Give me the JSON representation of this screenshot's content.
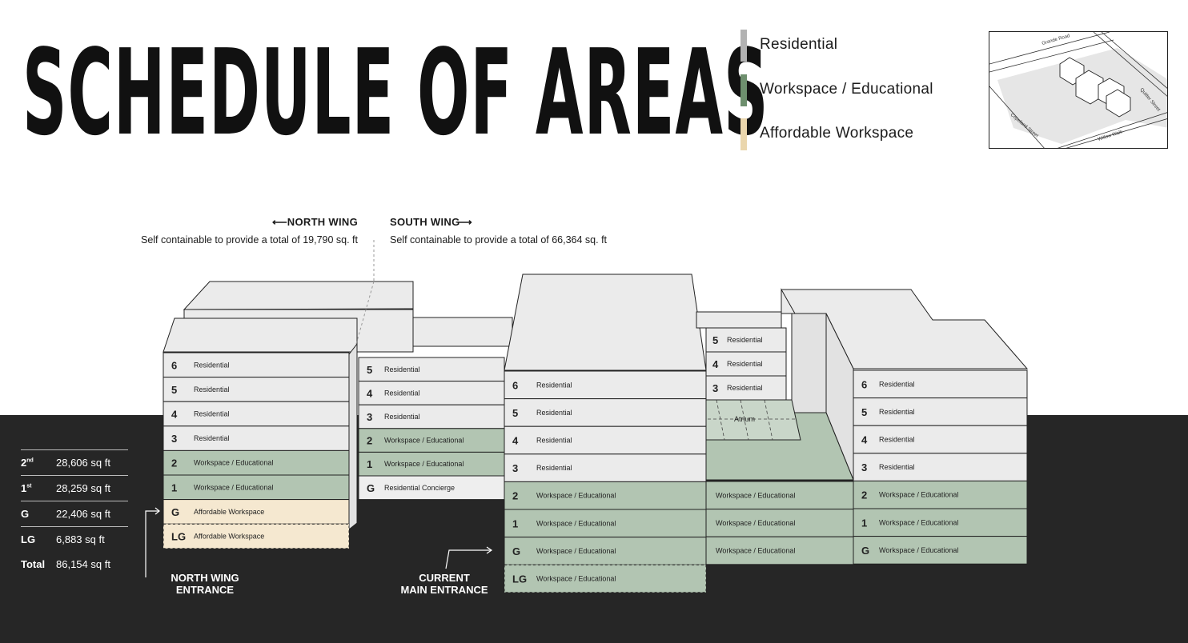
{
  "title": "SCHEDULE OF AREAS",
  "legend": [
    {
      "label": "Residential",
      "color": "#b2b2b2"
    },
    {
      "label": "Workspace / Educational",
      "color": "#6e8f6e"
    },
    {
      "label": "Affordable Workspace",
      "color": "#ead6ad"
    }
  ],
  "location_map": {
    "streets": [
      "Grande Road",
      "Quitter Street",
      "Willow Walk",
      "Copeland Street"
    ]
  },
  "wings": {
    "north": {
      "heading": "NORTH WING",
      "arrow": "⟵",
      "description": "Self containable to provide a total of 19,790 sq. ft"
    },
    "south": {
      "heading": "SOUTH WING",
      "arrow": "⟶",
      "description": "Self containable to provide a total of 66,364 sq. ft"
    }
  },
  "use_colors": {
    "residential": "#ebebeb",
    "workspace": "#b2c5b2",
    "affordable": "#f5e8d0",
    "concierge": "#eeeeee"
  },
  "blocks": {
    "north_wing": [
      {
        "num": "6",
        "label": "Residential",
        "use": "residential"
      },
      {
        "num": "5",
        "label": "Residential",
        "use": "residential"
      },
      {
        "num": "4",
        "label": "Residential",
        "use": "residential"
      },
      {
        "num": "3",
        "label": "Residential",
        "use": "residential"
      },
      {
        "num": "2",
        "label": "Workspace / Educational",
        "use": "workspace"
      },
      {
        "num": "1",
        "label": "Workspace / Educational",
        "use": "workspace"
      },
      {
        "num": "G",
        "label": "Affordable Workspace",
        "use": "affordable"
      },
      {
        "num": "LG",
        "label": "Affordable Workspace",
        "use": "affordable"
      }
    ],
    "link_block": [
      {
        "num": "5",
        "label": "Residential",
        "use": "residential"
      },
      {
        "num": "4",
        "label": "Residential",
        "use": "residential"
      },
      {
        "num": "3",
        "label": "Residential",
        "use": "residential"
      },
      {
        "num": "2",
        "label": "Workspace / Educational",
        "use": "workspace"
      },
      {
        "num": "1",
        "label": "Workspace / Educational",
        "use": "workspace"
      },
      {
        "num": "G",
        "label": "Residential Concierge",
        "use": "concierge"
      }
    ],
    "main_block": [
      {
        "num": "6",
        "label": "Residential",
        "use": "residential"
      },
      {
        "num": "5",
        "label": "Residential",
        "use": "residential"
      },
      {
        "num": "4",
        "label": "Residential",
        "use": "residential"
      },
      {
        "num": "3",
        "label": "Residential",
        "use": "residential"
      },
      {
        "num": "2",
        "label": "Workspace / Educational",
        "use": "workspace"
      },
      {
        "num": "1",
        "label": "Workspace / Educational",
        "use": "workspace"
      },
      {
        "num": "G",
        "label": "Workspace / Educational",
        "use": "workspace"
      },
      {
        "num": "LG",
        "label": "Workspace / Educational",
        "use": "workspace"
      }
    ],
    "atrium_block_upper": [
      {
        "num": "5",
        "label": "Residential",
        "use": "residential"
      },
      {
        "num": "4",
        "label": "Residential",
        "use": "residential"
      },
      {
        "num": "3",
        "label": "Residential",
        "use": "residential"
      }
    ],
    "atrium_label": "Atrium",
    "atrium_block_lower": [
      {
        "num": "",
        "label": "Workspace / Educational",
        "use": "workspace"
      },
      {
        "num": "",
        "label": "Workspace / Educational",
        "use": "workspace"
      },
      {
        "num": "",
        "label": "Workspace / Educational",
        "use": "workspace"
      }
    ],
    "east_block": [
      {
        "num": "6",
        "label": "Residential",
        "use": "residential"
      },
      {
        "num": "5",
        "label": "Residential",
        "use": "residential"
      },
      {
        "num": "4",
        "label": "Residential",
        "use": "residential"
      },
      {
        "num": "3",
        "label": "Residential",
        "use": "residential"
      },
      {
        "num": "2",
        "label": "Workspace / Educational",
        "use": "workspace"
      },
      {
        "num": "1",
        "label": "Workspace / Educational",
        "use": "workspace"
      },
      {
        "num": "G",
        "label": "Workspace / Educational",
        "use": "workspace"
      }
    ]
  },
  "entrances": {
    "north": {
      "line1": "NORTH WING",
      "line2": "ENTRANCE"
    },
    "main": {
      "line1": "CURRENT",
      "line2": "MAIN ENTRANCE"
    }
  },
  "area_schedule": [
    {
      "floor": "2",
      "sup": "nd",
      "value": "28,606 sq ft"
    },
    {
      "floor": "1",
      "sup": "st",
      "value": "28,259 sq ft"
    },
    {
      "floor": "G",
      "sup": "",
      "value": "22,406 sq ft"
    },
    {
      "floor": "LG",
      "sup": "",
      "value": "6,883 sq ft"
    },
    {
      "floor": "Total",
      "sup": "",
      "value": "86,154 sq ft"
    }
  ]
}
